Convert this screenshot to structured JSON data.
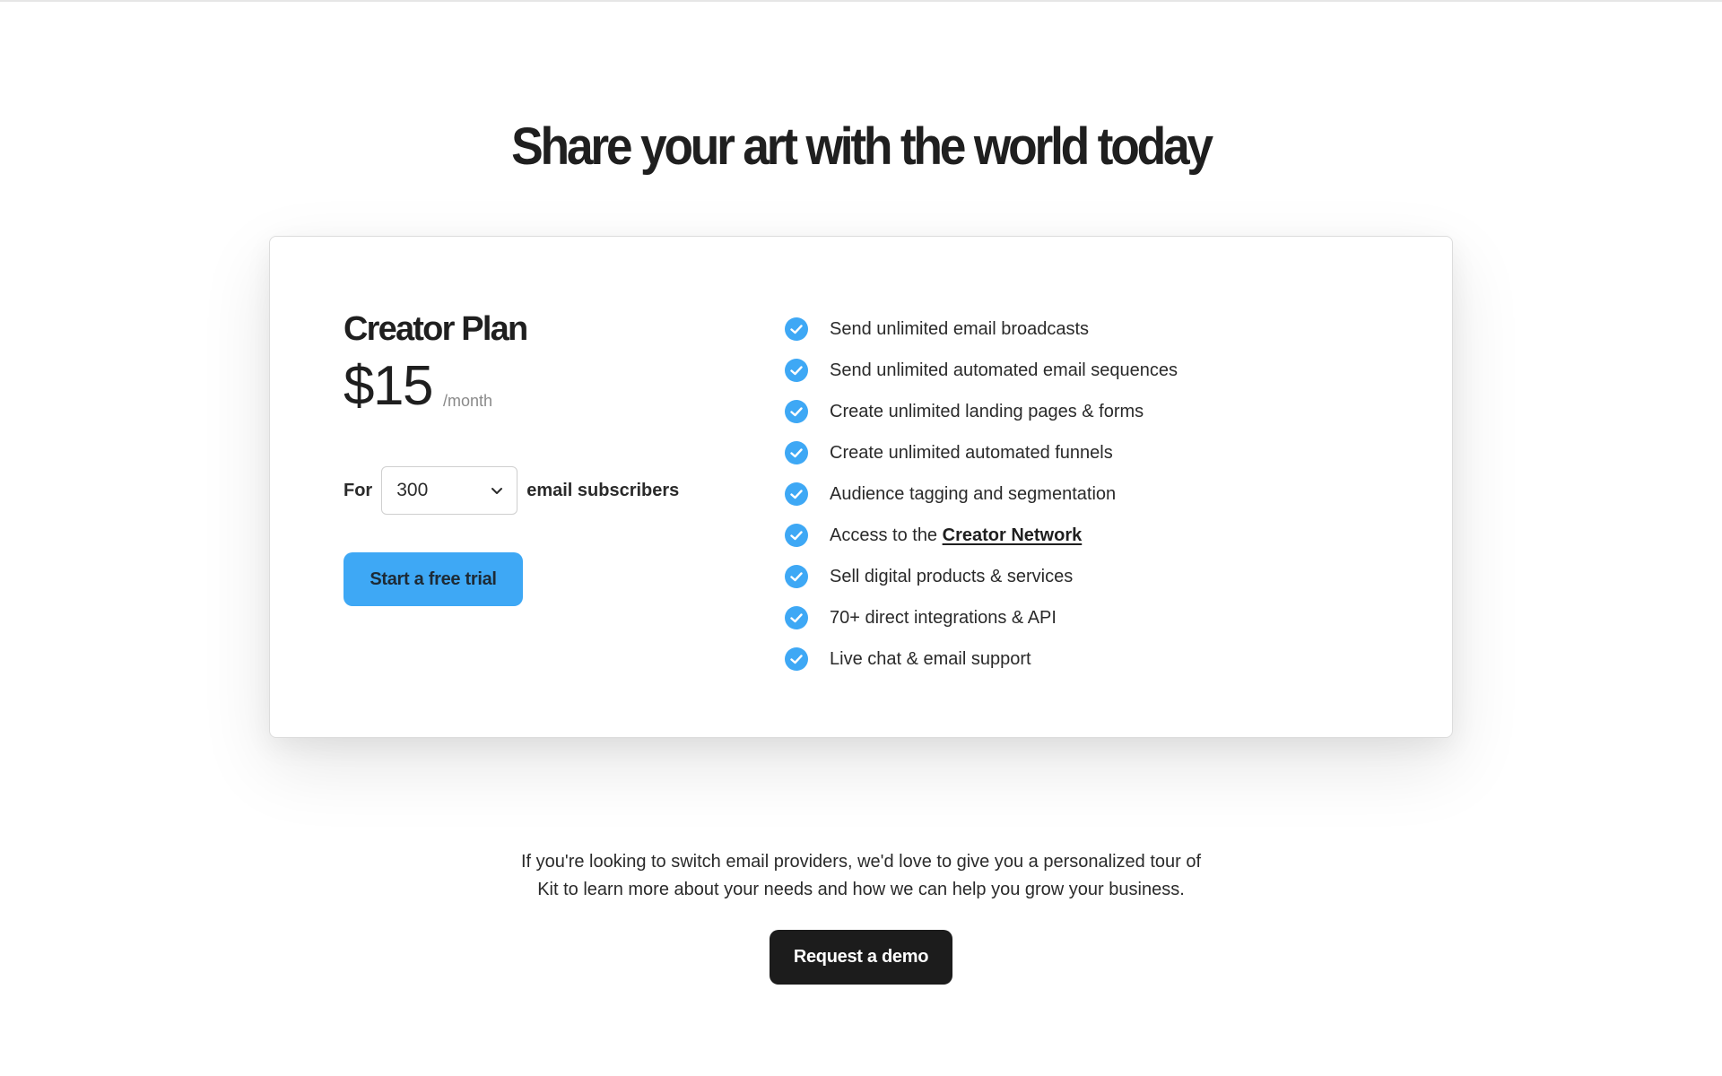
{
  "headline": "Share your art with the world today",
  "plan": {
    "name": "Creator Plan",
    "price": "$15",
    "period": "/month",
    "for_label": "For",
    "subscribers_value": "300",
    "subscribers_label": "email subscribers",
    "cta_label": "Start a free trial"
  },
  "features": [
    {
      "text": "Send unlimited email broadcasts"
    },
    {
      "text": "Send unlimited automated email sequences"
    },
    {
      "text": "Create unlimited landing pages & forms"
    },
    {
      "text": "Create unlimited automated funnels"
    },
    {
      "text": "Audience tagging and segmentation"
    },
    {
      "text": "Access to the ",
      "link": "Creator Network"
    },
    {
      "text": "Sell digital products & services"
    },
    {
      "text": "70+ direct integrations & API"
    },
    {
      "text": "Live chat & email support"
    }
  ],
  "tour": {
    "line1": "If you're looking to switch email providers, we'd love to give you a personalized tour of",
    "line2": "Kit to learn more about your needs and how we can help you grow your business.",
    "button_label": "Request a demo"
  },
  "colors": {
    "accent": "#3ea8f5",
    "dark_button": "#1c1c1c",
    "text": "#1f1f1f"
  },
  "icons": {
    "feature_check": "check-circle-icon",
    "select_arrow": "chevron-down-icon"
  }
}
